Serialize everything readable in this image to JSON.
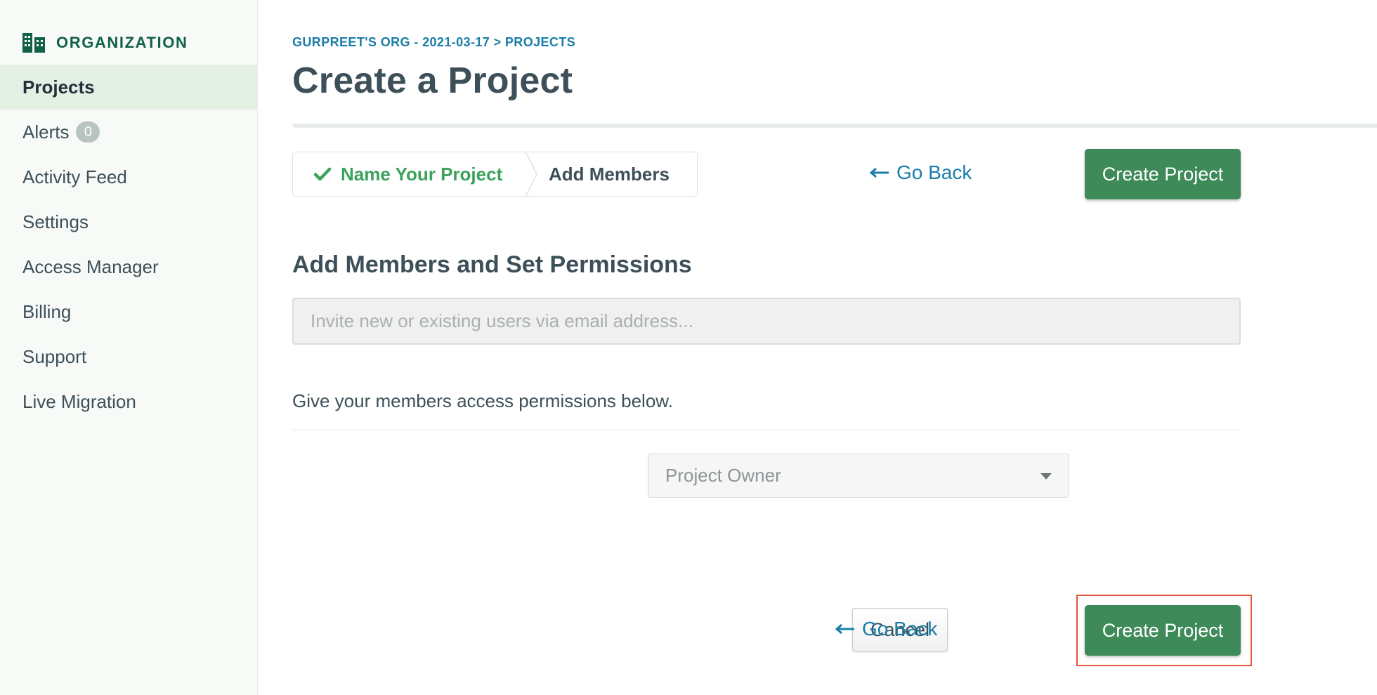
{
  "sidebar": {
    "header_label": "ORGANIZATION",
    "items": [
      {
        "label": "Projects",
        "active": true
      },
      {
        "label": "Alerts",
        "badge": "0"
      },
      {
        "label": "Activity Feed"
      },
      {
        "label": "Settings"
      },
      {
        "label": "Access Manager"
      },
      {
        "label": "Billing"
      },
      {
        "label": "Support"
      },
      {
        "label": "Live Migration"
      }
    ]
  },
  "header": {
    "breadcrumb": "GURPREET'S ORG - 2021-03-17 > PROJECTS",
    "title": "Create a Project"
  },
  "wizard": {
    "steps": [
      {
        "label": "Name Your Project",
        "status": "done"
      },
      {
        "label": "Add Members",
        "status": "current"
      }
    ],
    "go_back_label": "Go Back",
    "create_label": "Create Project"
  },
  "members": {
    "section_title": "Add Members and Set Permissions",
    "invite_placeholder": "Invite new or existing users via email address...",
    "permissions_text": "Give your members access permissions below.",
    "role_selected": "Project Owner"
  },
  "footer": {
    "cancel_label": "Cancel",
    "go_back_label": "Go Back",
    "create_label": "Create Project"
  },
  "colors": {
    "accent_green": "#3e8a58",
    "link_blue": "#1a7ea8",
    "done_green": "#3ba25c",
    "highlight_red": "#e0563f"
  },
  "icons": {
    "org": "building-icon",
    "check": "check-icon",
    "back": "arrow-left-icon",
    "caret": "caret-down-icon"
  }
}
